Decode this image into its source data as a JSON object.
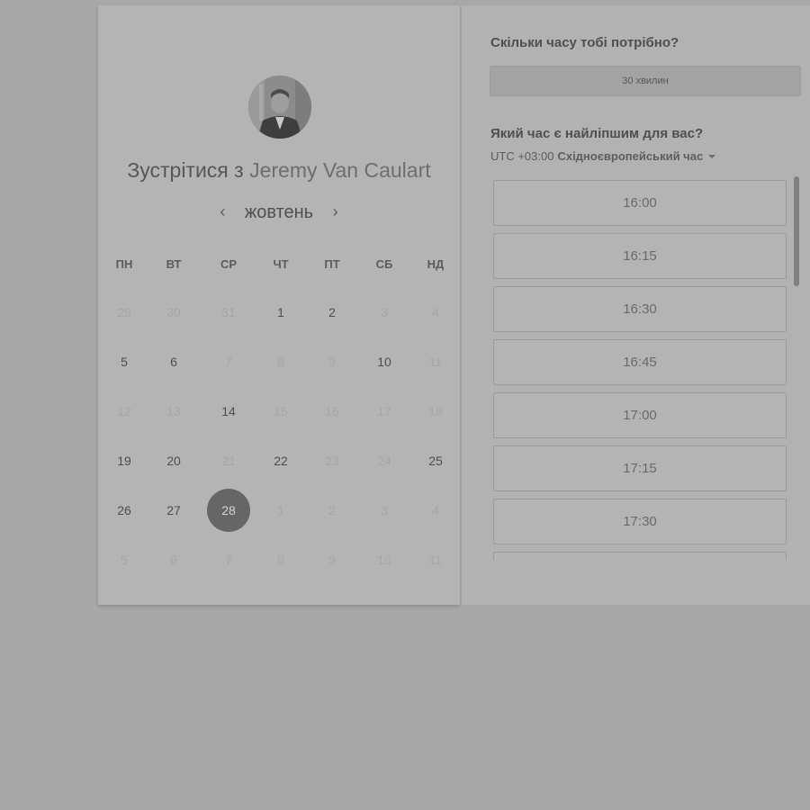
{
  "host": {
    "meet_prefix": "Зустрітися з",
    "name": "Jeremy Van Caulart",
    "avatar_icon": "person-photo"
  },
  "calendar": {
    "month": "жовтень",
    "prev_icon": "chevron-left-icon",
    "next_icon": "chevron-right-icon",
    "weekdays": [
      "ПН",
      "ВТ",
      "СР",
      "ЧТ",
      "ПТ",
      "СБ",
      "НД"
    ],
    "weeks": [
      [
        {
          "d": "29",
          "muted": true
        },
        {
          "d": "30",
          "muted": true
        },
        {
          "d": "31",
          "muted": true
        },
        {
          "d": "1",
          "muted": false
        },
        {
          "d": "2",
          "muted": false
        },
        {
          "d": "3",
          "muted": true
        },
        {
          "d": "4",
          "muted": true
        }
      ],
      [
        {
          "d": "5",
          "muted": false
        },
        {
          "d": "6",
          "muted": false
        },
        {
          "d": "7",
          "muted": true
        },
        {
          "d": "8",
          "muted": true
        },
        {
          "d": "9",
          "muted": true
        },
        {
          "d": "10",
          "muted": false
        },
        {
          "d": "11",
          "muted": true
        }
      ],
      [
        {
          "d": "12",
          "muted": true
        },
        {
          "d": "13",
          "muted": true
        },
        {
          "d": "14",
          "muted": false
        },
        {
          "d": "15",
          "muted": true
        },
        {
          "d": "16",
          "muted": true
        },
        {
          "d": "17",
          "muted": true
        },
        {
          "d": "18",
          "muted": true
        }
      ],
      [
        {
          "d": "19",
          "muted": false
        },
        {
          "d": "20",
          "muted": false
        },
        {
          "d": "21",
          "muted": true
        },
        {
          "d": "22",
          "muted": false
        },
        {
          "d": "23",
          "muted": true
        },
        {
          "d": "24",
          "muted": true
        },
        {
          "d": "25",
          "muted": false
        }
      ],
      [
        {
          "d": "26",
          "muted": false
        },
        {
          "d": "27",
          "muted": false
        },
        {
          "d": "28",
          "muted": false,
          "selected": true
        },
        {
          "d": "1",
          "muted": true
        },
        {
          "d": "2",
          "muted": true
        },
        {
          "d": "3",
          "muted": true
        },
        {
          "d": "4",
          "muted": true
        }
      ],
      [
        {
          "d": "5",
          "muted": true
        },
        {
          "d": "6",
          "muted": true
        },
        {
          "d": "7",
          "muted": true
        },
        {
          "d": "8",
          "muted": true
        },
        {
          "d": "9",
          "muted": true
        },
        {
          "d": "10",
          "muted": true
        },
        {
          "d": "11",
          "muted": true
        }
      ]
    ]
  },
  "booking": {
    "duration_question": "Скільки часу тобі потрібно?",
    "duration_value": "30 хвилин",
    "time_question": "Який час є найліпшим для вас?",
    "timezone_offset": "UTC +03:00",
    "timezone_name": "Східноєвропейський час",
    "slots": [
      "16:00",
      "16:15",
      "16:30",
      "16:45",
      "17:00",
      "17:15",
      "17:30",
      ""
    ]
  },
  "colors": {
    "backdrop": "#a8a8a8",
    "selected_day": "#666666"
  }
}
